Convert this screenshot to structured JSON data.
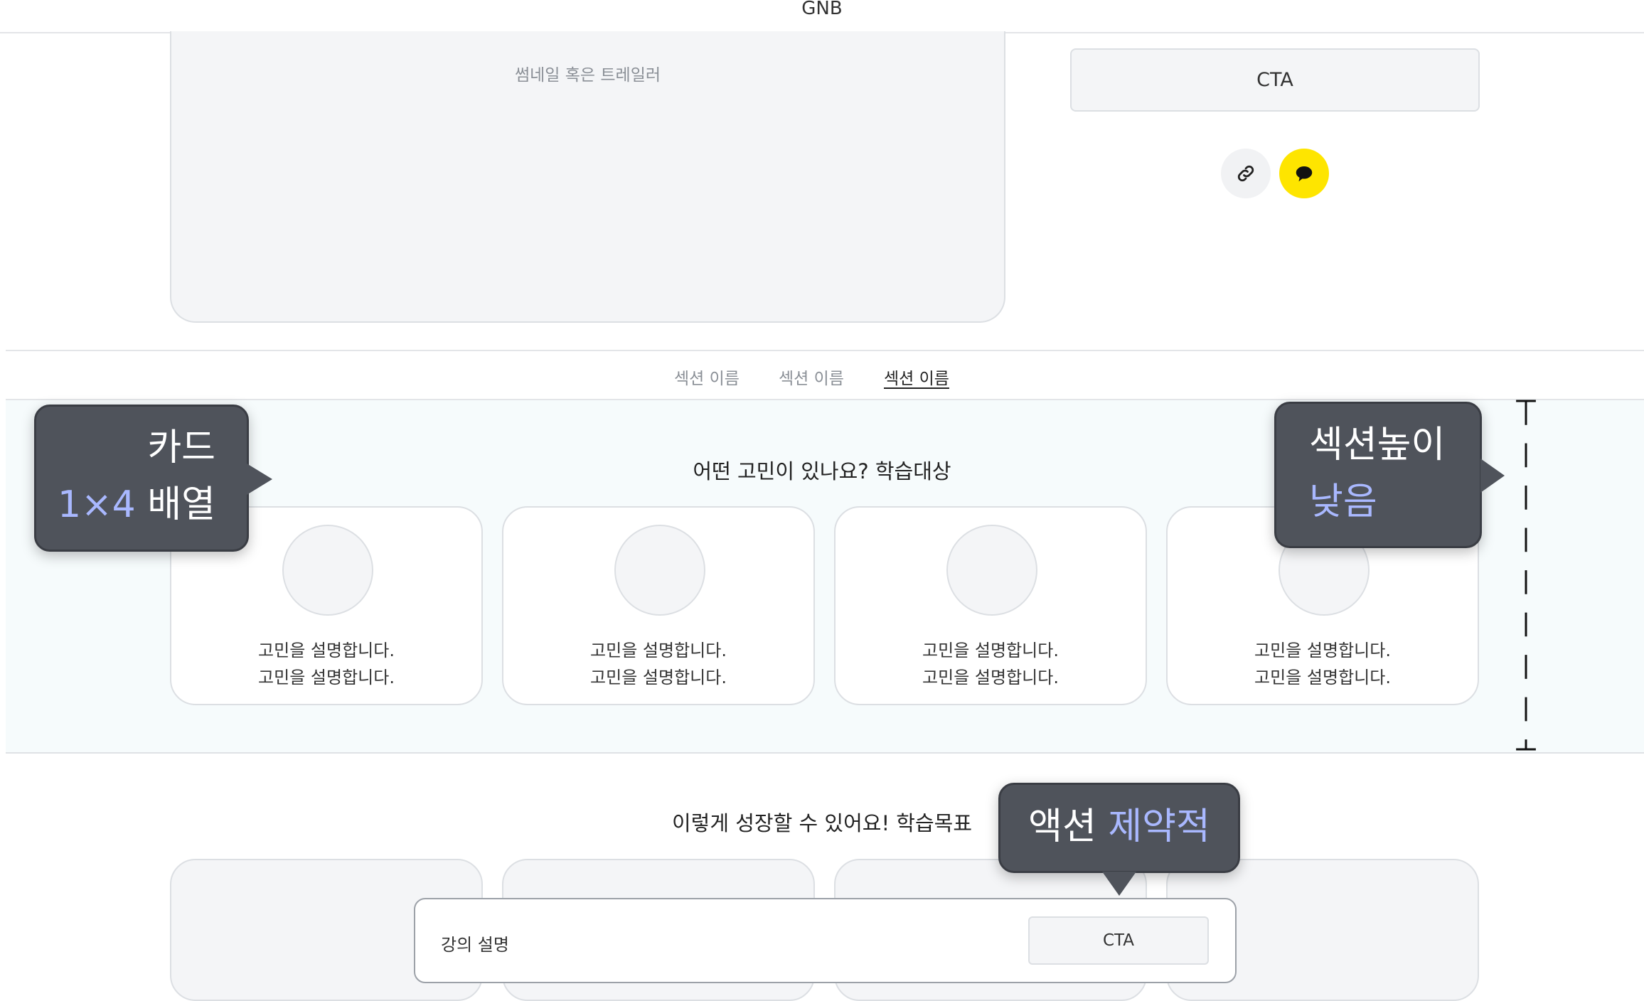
{
  "gnb": {
    "label": "GNB"
  },
  "hero": {
    "thumbnail_label": "썸네일 혹은 트레일러",
    "cta_label": "CTA",
    "share_link_icon": "link-icon",
    "share_kakao_icon": "kakao-chat-icon",
    "kakao_color": "#fee500"
  },
  "tabs": [
    {
      "label": "섹션 이름",
      "active": false
    },
    {
      "label": "섹션 이름",
      "active": false
    },
    {
      "label": "섹션 이름",
      "active": true
    }
  ],
  "section1": {
    "title": "어떤 고민이 있나요? 학습대상",
    "cards": [
      {
        "line1": "고민을 설명합니다.",
        "line2": "고민을 설명합니다."
      },
      {
        "line1": "고민을 설명합니다.",
        "line2": "고민을 설명합니다."
      },
      {
        "line1": "고민을 설명합니다.",
        "line2": "고민을 설명합니다."
      },
      {
        "line1": "고민을 설명합니다.",
        "line2": "고민을 설명합니다."
      }
    ]
  },
  "section2": {
    "title": "이렇게 성장할 수 있어요! 학습목표"
  },
  "action_bar": {
    "label": "강의 설명",
    "cta_label": "CTA"
  },
  "annotations": {
    "card_tip": {
      "line1": "카드",
      "line2_highlight": "1×4",
      "line2_rest": " 배열"
    },
    "height_tip": {
      "line1": "섹션높이",
      "line2_highlight": "낮음"
    },
    "action_tip": {
      "text": "액션 ",
      "highlight": "제약적"
    },
    "highlight_color": "#a9b8ff"
  }
}
